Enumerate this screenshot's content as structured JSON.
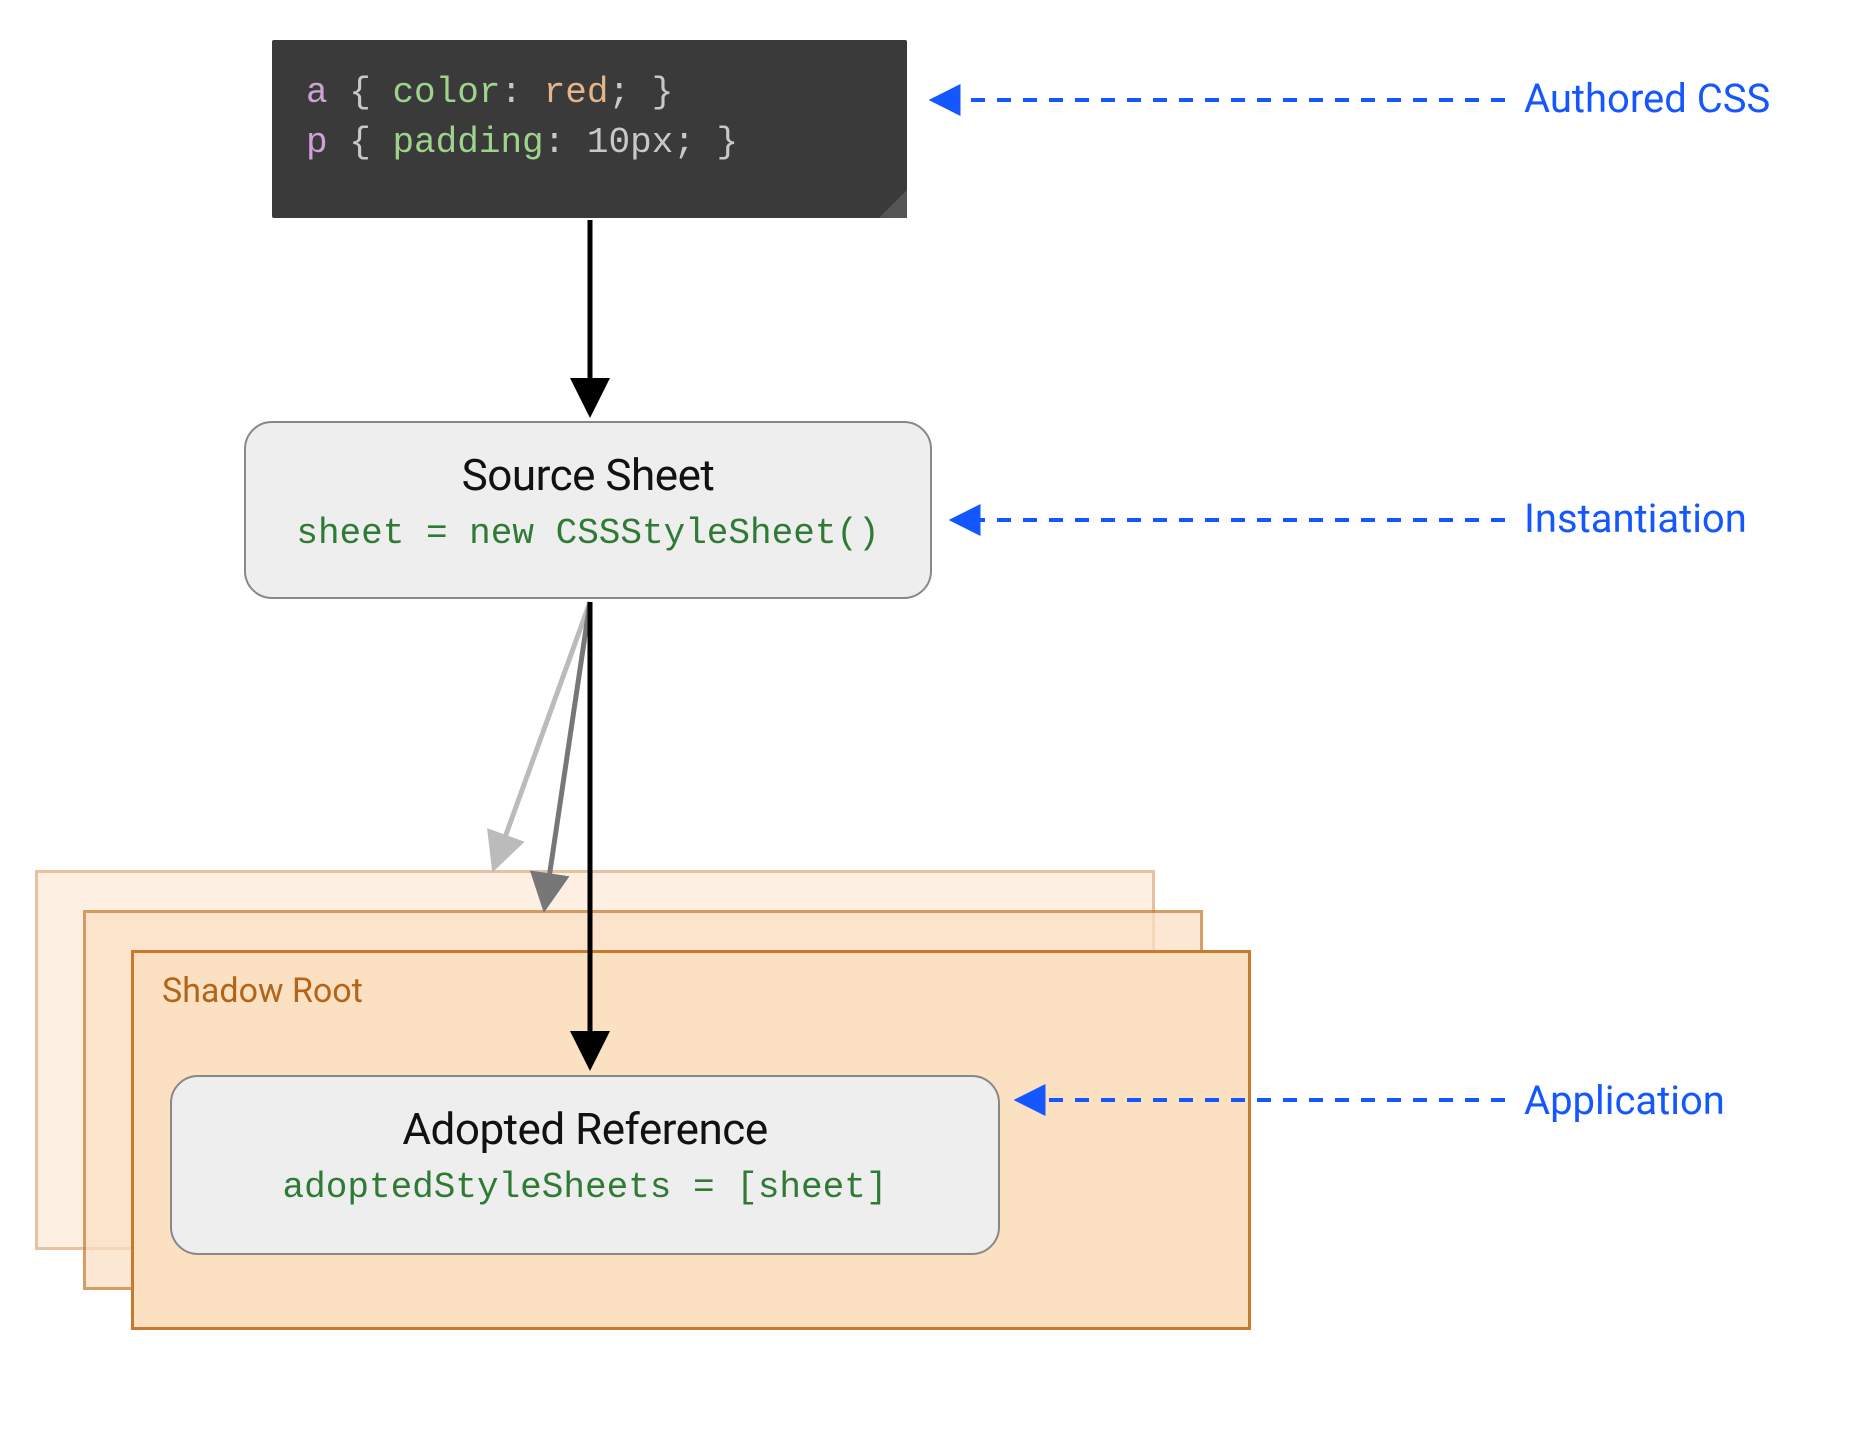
{
  "code": {
    "line1": {
      "selector": "a",
      "open": "{",
      "prop": "color",
      "colon": ":",
      "value": "red",
      "semi": ";",
      "close": "}"
    },
    "line2": {
      "selector": "p",
      "open": "{",
      "prop": "padding",
      "colon": ":",
      "value": "10px",
      "semi": ";",
      "close": "}"
    }
  },
  "source_sheet": {
    "title": "Source Sheet",
    "code": "sheet = new CSSStyleSheet()"
  },
  "shadow_root": {
    "label": "Shadow Root"
  },
  "adopted_reference": {
    "title": "Adopted Reference",
    "code": "adoptedStyleSheets = [sheet]"
  },
  "annotations": {
    "authored_css": "Authored CSS",
    "instantiation": "Instantiation",
    "application": "Application"
  },
  "colors": {
    "blue": "#1557ff",
    "orange_border": "#c77a2e",
    "orange_fill": "#fbe0c2",
    "code_bg": "#3a3a3a",
    "code_prop": "#9fd28a",
    "code_sel": "#cfa1d8",
    "code_val": "#e6b48a",
    "box_bg": "#eeeeee",
    "box_border": "#888888",
    "green_code": "#2f7a35"
  }
}
